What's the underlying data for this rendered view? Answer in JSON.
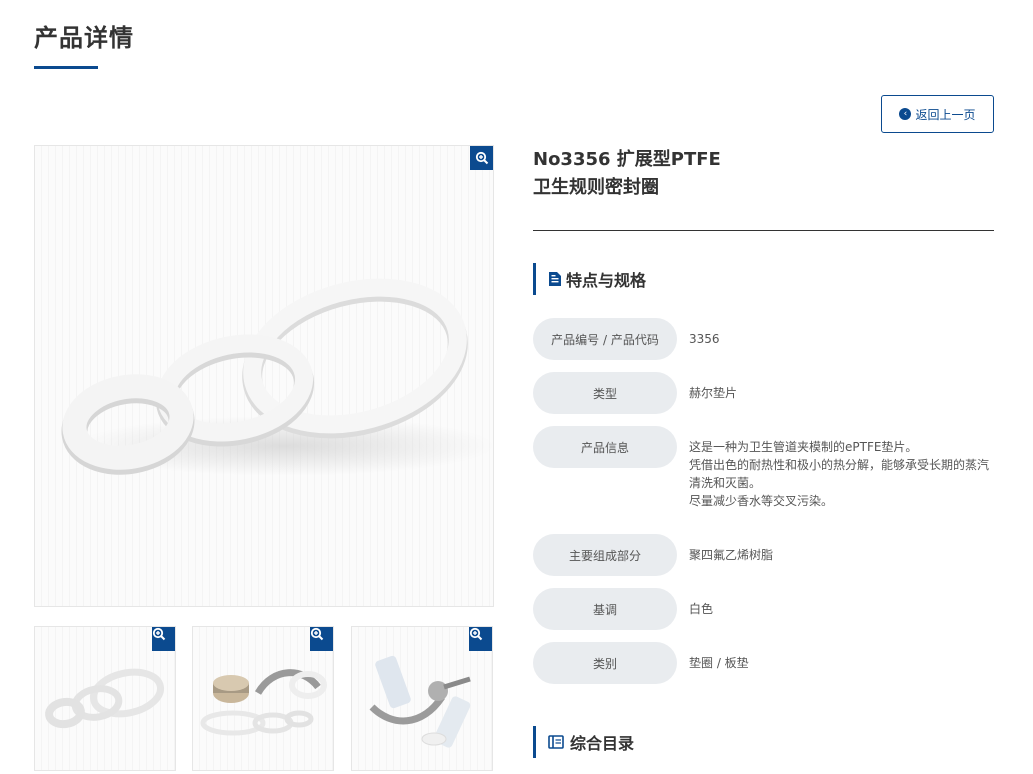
{
  "page": {
    "title": "产品详情"
  },
  "back_button": {
    "label": "返回上一页"
  },
  "product": {
    "name_line1": "No3356 扩展型PTFE",
    "name_line2": "卫生规则密封圈"
  },
  "features_section": {
    "heading": "特点与规格",
    "icon": "document-icon"
  },
  "specs": [
    {
      "label": "产品编号 / 产品代码",
      "value_lines": [
        "3356"
      ]
    },
    {
      "label": "类型",
      "value_lines": [
        "赫尔垫片"
      ]
    },
    {
      "label": "产品信息",
      "value_lines": [
        "这是一种为卫生管道夹模制的ePTFE垫片。",
        "凭借出色的耐热性和极小的热分解，能够承受长期的蒸汽",
        "清洗和灭菌。",
        "尽量减少香水等交叉污染。"
      ]
    },
    {
      "label": "主要组成部分",
      "value_lines": [
        "聚四氟乙烯树脂"
      ]
    },
    {
      "label": "基调",
      "value_lines": [
        "白色"
      ]
    },
    {
      "label": "类别",
      "value_lines": [
        "垫圈 / 板垫"
      ]
    }
  ],
  "catalog_section": {
    "heading": "综合目录",
    "icon": "book-icon"
  },
  "icons": {
    "zoom": "zoom-in-icon",
    "back": "arrow-left-circle-icon"
  },
  "colors": {
    "accent": "#0b4a8f",
    "label_bg": "#e9ecef"
  }
}
